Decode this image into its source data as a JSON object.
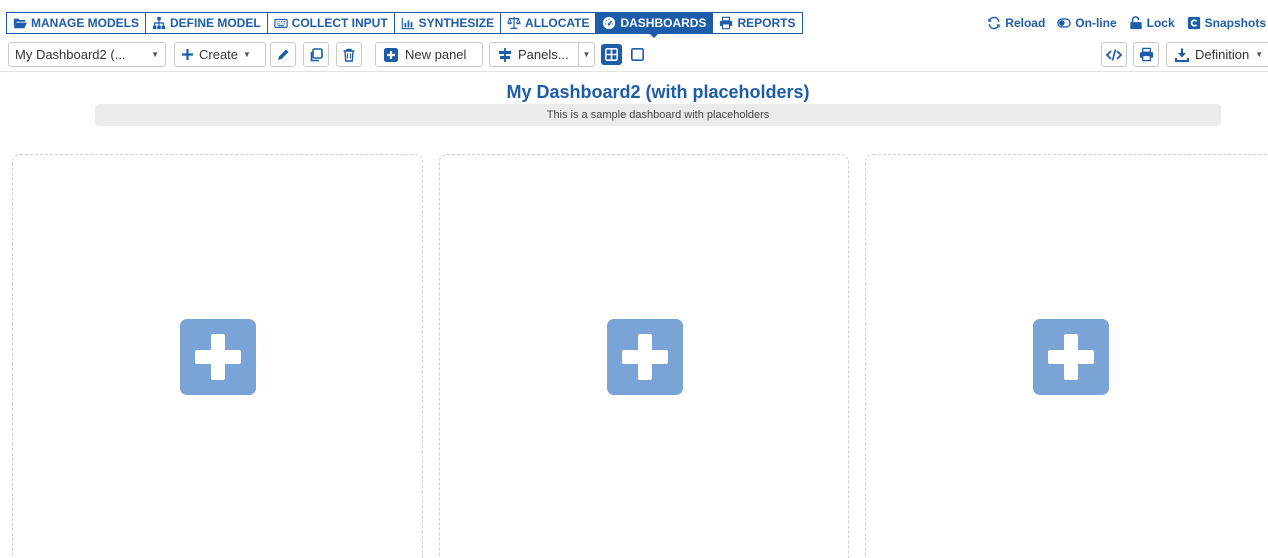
{
  "nav": {
    "tabs": [
      {
        "label": "MANAGE MODELS",
        "icon": "folder-open-icon"
      },
      {
        "label": "DEFINE MODEL",
        "icon": "sitemap-icon"
      },
      {
        "label": "COLLECT INPUT",
        "icon": "keyboard-icon"
      },
      {
        "label": "SYNTHESIZE",
        "icon": "bar-chart-icon"
      },
      {
        "label": "ALLOCATE",
        "icon": "balance-scale-icon"
      },
      {
        "label": "DASHBOARDS",
        "icon": "tachometer-icon",
        "active": true
      },
      {
        "label": "REPORTS",
        "icon": "print-icon"
      }
    ],
    "right": [
      {
        "label": "Reload",
        "icon": "refresh-icon"
      },
      {
        "label": "On-line",
        "icon": "toggle-icon"
      },
      {
        "label": "Lock",
        "icon": "unlock-icon"
      },
      {
        "label": "Snapshots",
        "icon": "camera-icon"
      }
    ]
  },
  "toolbar": {
    "dashboard_select": "My Dashboard2 (...",
    "create_label": "Create",
    "new_panel_label": "New panel",
    "panels_label": "Panels...",
    "definition_label": "Definition"
  },
  "dashboard": {
    "title": "My Dashboard2 (with placeholders)",
    "description": "This is a sample dashboard with placeholders"
  },
  "colors": {
    "brand": "#1d5ca8",
    "placeholder_button": "#7aa3d6",
    "panel_border": "#cfcfcf"
  }
}
